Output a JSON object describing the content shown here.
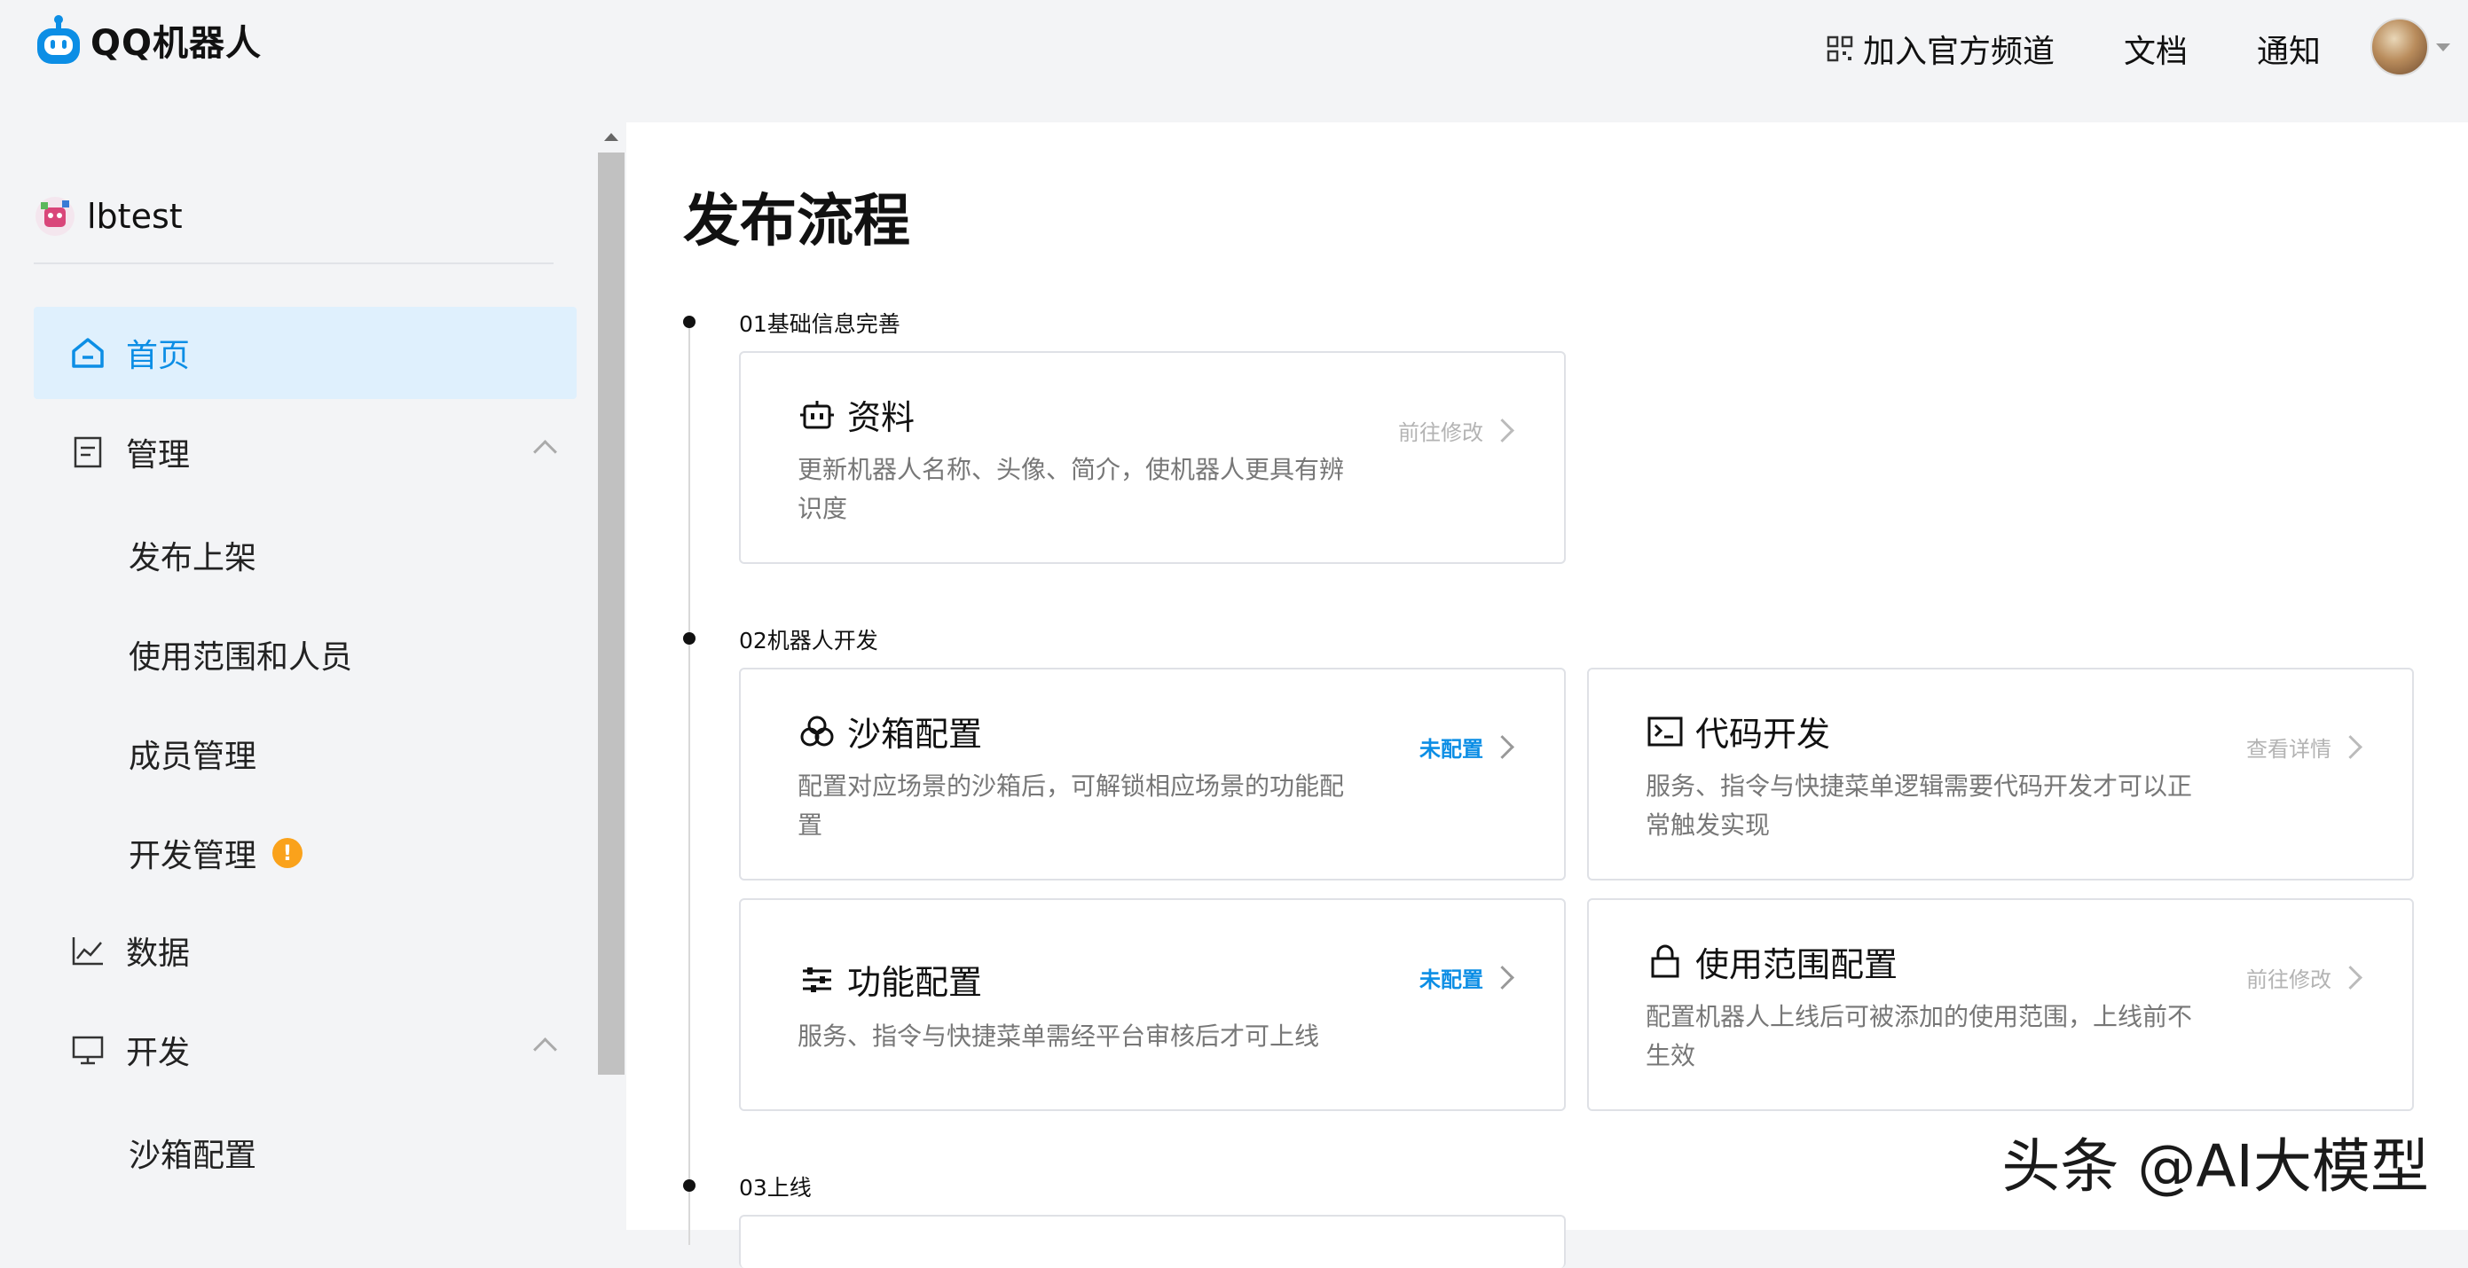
{
  "header": {
    "logo_text": "QQ机器人",
    "nav": [
      {
        "label": "加入官方频道",
        "icon": "qrcode-icon"
      },
      {
        "label": "文档"
      },
      {
        "label": "通知"
      }
    ]
  },
  "sidebar": {
    "bot_name": "lbtest",
    "menu": [
      {
        "label": "首页",
        "icon": "home-icon",
        "active": true
      },
      {
        "label": "管理",
        "icon": "document-icon",
        "expanded": true
      },
      {
        "label": "数据",
        "icon": "line-chart-icon"
      },
      {
        "label": "开发",
        "icon": "monitor-icon",
        "expanded": true
      }
    ],
    "submenu_manage": [
      "发布上架",
      "使用范围和人员",
      "成员管理",
      "开发管理"
    ],
    "submenu_dev": [
      "沙箱配置"
    ],
    "dev_manage_badge": "!"
  },
  "main": {
    "title": "发布流程",
    "steps": [
      {
        "label": "01基础信息完善"
      },
      {
        "label": "02机器人开发"
      },
      {
        "label": "03上线"
      }
    ],
    "cards": [
      {
        "title": "资料",
        "icon": "robot-icon",
        "desc": "更新机器人名称、头像、简介，使机器人更具有辨识度",
        "action": "前往修改",
        "action_style": "gray"
      },
      {
        "title": "沙箱配置",
        "icon": "sandbox-icon",
        "desc": "配置对应场景的沙箱后，可解锁相应场景的功能配置",
        "action": "未配置",
        "action_style": "blue"
      },
      {
        "title": "代码开发",
        "icon": "terminal-icon",
        "desc": "服务、指令与快捷菜单逻辑需要代码开发才可以正常触发实现",
        "action": "查看详情",
        "action_style": "gray"
      },
      {
        "title": "功能配置",
        "icon": "sliders-icon",
        "desc": "服务、指令与快捷菜单需经平台审核后才可上线",
        "action": "未配置",
        "action_style": "blue"
      },
      {
        "title": "使用范围配置",
        "icon": "lock-icon",
        "desc": "配置机器人上线后可被添加的使用范围，上线前不生效",
        "action": "前往修改",
        "action_style": "gray"
      }
    ]
  },
  "watermark": "头条 @AI大模型",
  "colors": {
    "accent": "#0c8ee5",
    "active_bg": "#dff0fd",
    "warning": "#faa21b"
  }
}
